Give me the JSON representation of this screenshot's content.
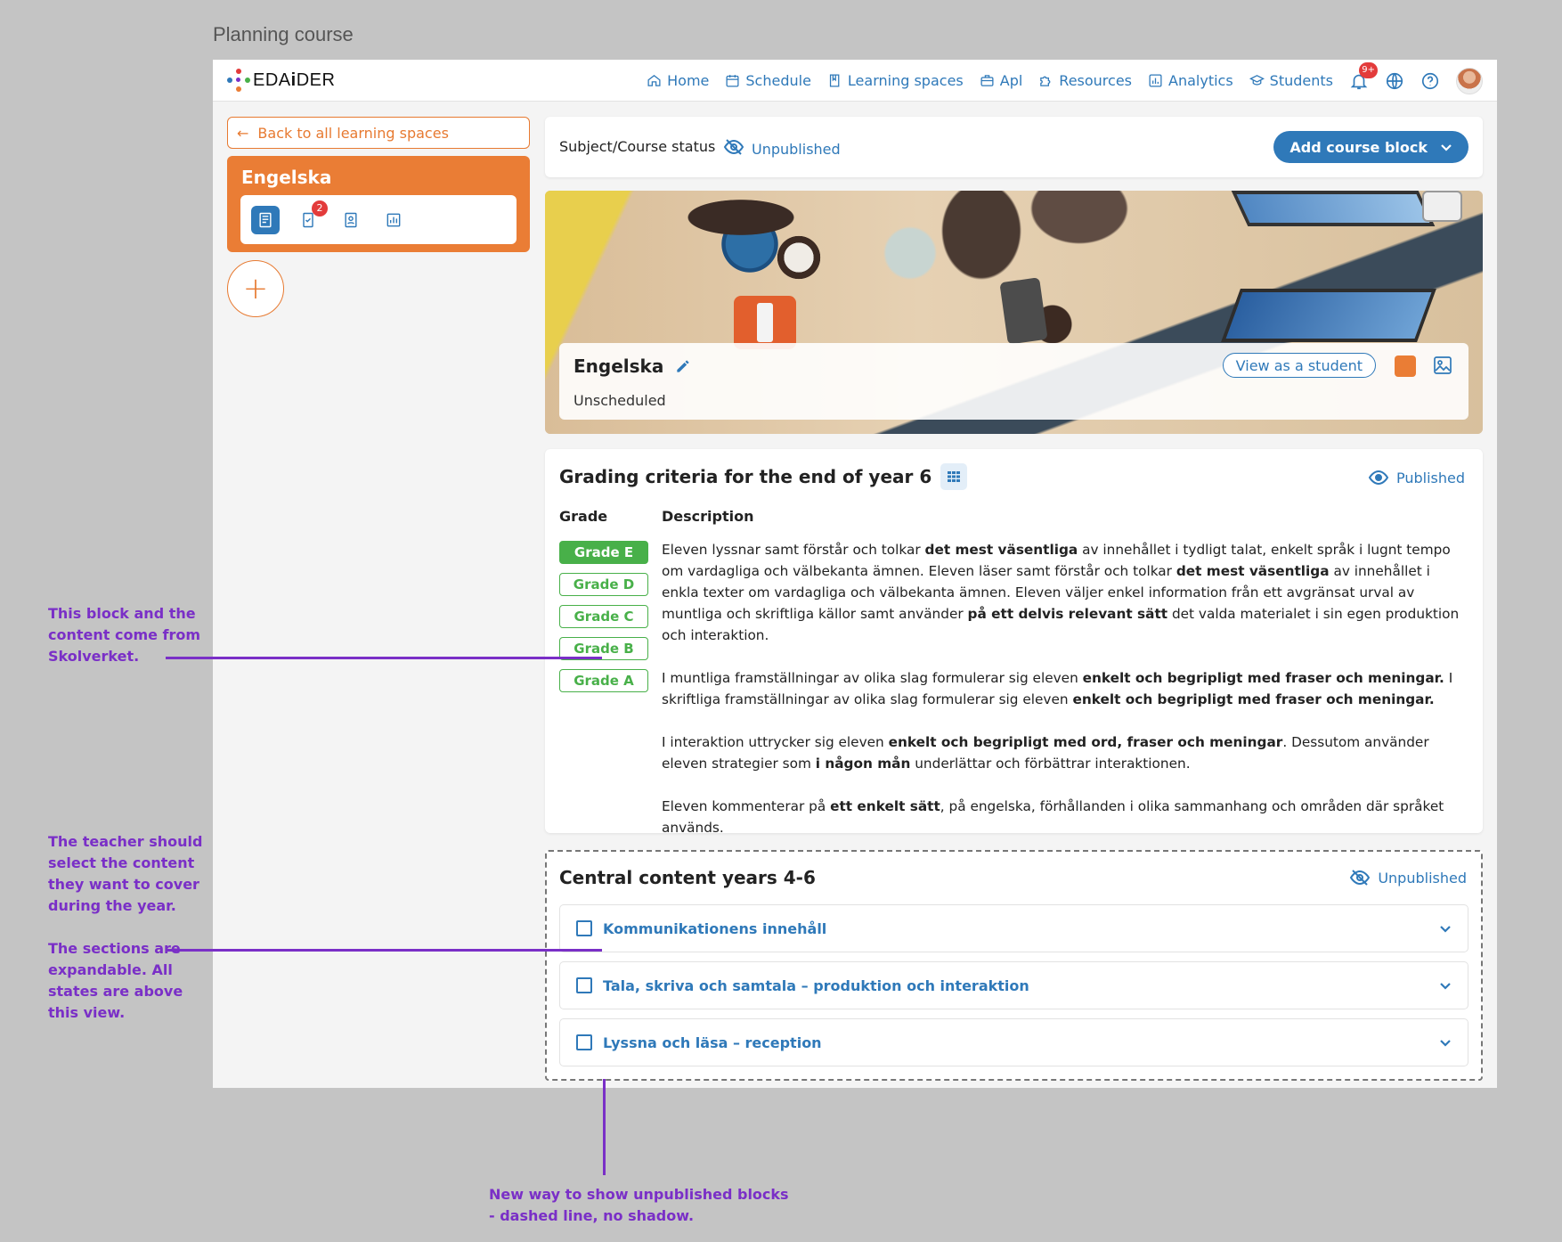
{
  "canvas_title": "Planning course",
  "app": {
    "logo_prefix": "EDA",
    "logo_i": "i",
    "logo_suffix": "DER"
  },
  "nav": {
    "items": [
      {
        "label": "Home",
        "icon": "home-icon"
      },
      {
        "label": "Schedule",
        "icon": "calendar-icon"
      },
      {
        "label": "Learning spaces",
        "icon": "book-icon"
      },
      {
        "label": "Apl",
        "icon": "briefcase-icon"
      },
      {
        "label": "Resources",
        "icon": "puzzle-icon"
      },
      {
        "label": "Analytics",
        "icon": "chart-icon"
      },
      {
        "label": "Students",
        "icon": "graduation-icon"
      }
    ],
    "notification_count": "9+"
  },
  "sidebar": {
    "back_label": "Back to all learning spaces",
    "subject_title": "Engelska",
    "tool_badge": "2"
  },
  "status_bar": {
    "label": "Subject/Course status",
    "state": "Unpublished",
    "add_block_label": "Add course block"
  },
  "hero": {
    "title": "Engelska",
    "schedule": "Unscheduled",
    "view_student_label": "View as a student",
    "color": "#ea7d35"
  },
  "grading": {
    "title": "Grading criteria for the end of year 6",
    "state": "Published",
    "col_grade": "Grade",
    "col_description": "Description",
    "grades": [
      "Grade E",
      "Grade D",
      "Grade C",
      "Grade B",
      "Grade A"
    ],
    "active_grade": "Grade E",
    "p1": [
      "Eleven lyssnar samt förstår och tolkar ",
      "det mest väsentliga",
      " av innehållet i tydligt talat, enkelt språk i lugnt tempo om vardagliga och välbekanta ämnen. Eleven läser samt förstår och tolkar ",
      "det mest väsentliga",
      " av innehållet i enkla texter om vardagliga och välbekanta ämnen. Eleven väljer enkel information från ett avgränsat urval av muntliga och skriftliga källor samt använder ",
      "på ett delvis relevant sätt",
      " det valda materialet i sin egen produktion och interaktion."
    ],
    "p2": [
      "I muntliga framställningar av olika slag formulerar sig eleven ",
      "enkelt och begripligt med fraser och meningar.",
      " I skriftliga framställningar av olika slag formulerar sig eleven ",
      "enkelt och begripligt med fraser och meningar."
    ],
    "p3": [
      "I interaktion uttrycker sig eleven ",
      "enkelt och begripligt med ord, fraser och meningar",
      ". Dessutom använder eleven strategier som ",
      "i någon mån",
      " underlättar och förbättrar interaktionen."
    ],
    "p4": [
      "Eleven kommenterar på ",
      "ett enkelt sätt",
      ", på engelska, förhållanden i olika sammanhang och områden där språket används."
    ]
  },
  "central": {
    "title": "Central content years 4-6",
    "state": "Unpublished",
    "sections": [
      "Kommunikationens innehåll",
      "Tala, skriva och samtala – produktion och interaktion",
      "Lyssna och läsa – reception"
    ]
  },
  "annotations": {
    "note1": [
      "This block and the",
      "content come from",
      "Skolverket."
    ],
    "note2": [
      "The teacher should",
      "select the content",
      "they want to cover",
      "during the year."
    ],
    "note3": [
      "The sections are",
      "expandable. All",
      "states are above",
      "this view."
    ],
    "note4": [
      "New way to show unpublished blocks",
      "- dashed line, no shadow."
    ],
    "color": "#7a2fc7"
  }
}
